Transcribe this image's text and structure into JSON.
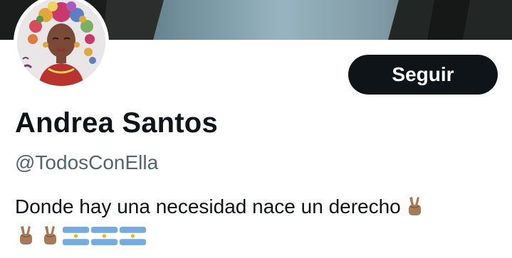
{
  "profile": {
    "display_name": "Andrea Santos",
    "handle": "@TodosConElla",
    "bio_text": "Donde hay una necesidad nace un derecho",
    "follow_label": "Seguir"
  },
  "bio_emojis": {
    "line1": [
      "victory-hand-medium-skin-tone"
    ],
    "line2": [
      "victory-hand-medium-skin-tone",
      "victory-hand-medium-skin-tone",
      "flag-argentina",
      "flag-argentina",
      "flag-argentina"
    ]
  },
  "colors": {
    "text_primary": "#0f1419",
    "text_secondary": "#536471",
    "button_bg": "#0f1419",
    "button_text": "#ffffff",
    "skin_tone": "#a87a55",
    "flag_blue": "#74acdf",
    "flag_sun": "#f6b40e"
  }
}
